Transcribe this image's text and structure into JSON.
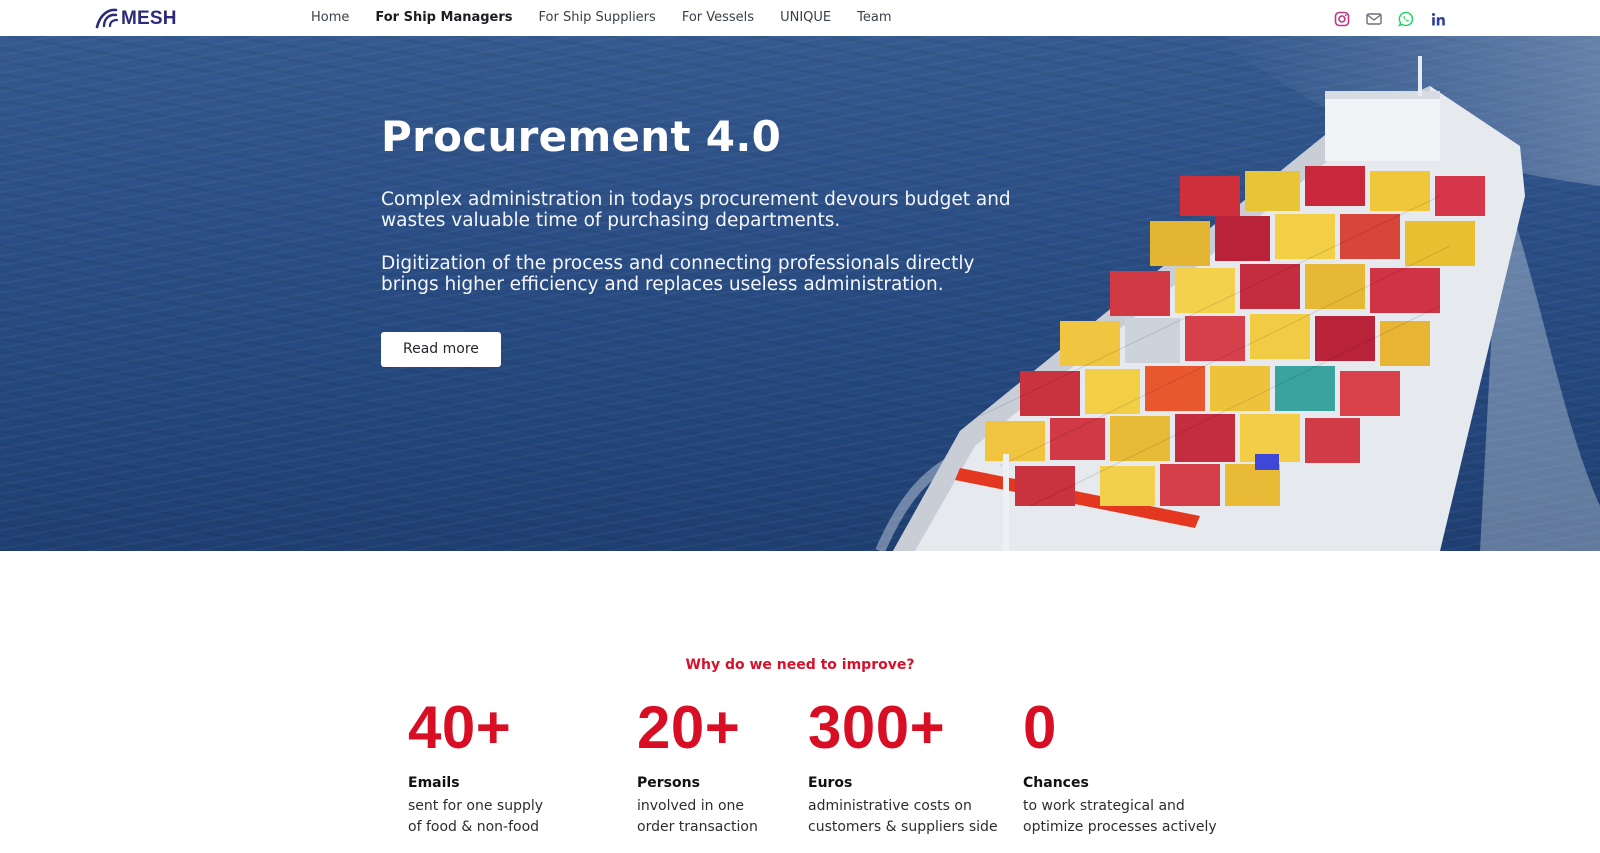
{
  "brand": {
    "name": "MESH",
    "color": "#2b2a7a"
  },
  "nav": {
    "items": [
      {
        "label": "Home",
        "active": false
      },
      {
        "label": "For Ship Managers",
        "active": true
      },
      {
        "label": "For Ship Suppliers",
        "active": false
      },
      {
        "label": "For Vessels",
        "active": false
      },
      {
        "label": "UNIQUE",
        "active": false
      },
      {
        "label": "Team",
        "active": false
      }
    ]
  },
  "social": {
    "icons": [
      "instagram-icon",
      "mail-icon",
      "whatsapp-icon",
      "linkedin-icon"
    ],
    "colors": {
      "instagram": "#c13584",
      "mail": "#6b7078",
      "whatsapp": "#25d366",
      "linkedin": "#2b3fa0"
    }
  },
  "hero": {
    "title": "Procurement 4.0",
    "paragraph_1": "Complex administration in todays procurement devours budget and wastes valuable time of purchasing departments.",
    "paragraph_2": "Digitization of the process and connecting professionals directly brings higher efficiency and replaces useless administration.",
    "button_label": "Read more"
  },
  "stats": {
    "heading": "Why do we need to improve?",
    "accent": "#d80f24",
    "items": [
      {
        "number": "40+",
        "label": "Emails",
        "description": "sent for one supply\nof food & non-food"
      },
      {
        "number": "20+",
        "label": "Persons",
        "description": "involved in one\norder transaction"
      },
      {
        "number": "300+",
        "label": "Euros",
        "description": "administrative costs on\ncustomers & suppliers side"
      },
      {
        "number": "0",
        "label": "Chances",
        "description": "to work strategical and\noptimize processes actively"
      }
    ]
  }
}
